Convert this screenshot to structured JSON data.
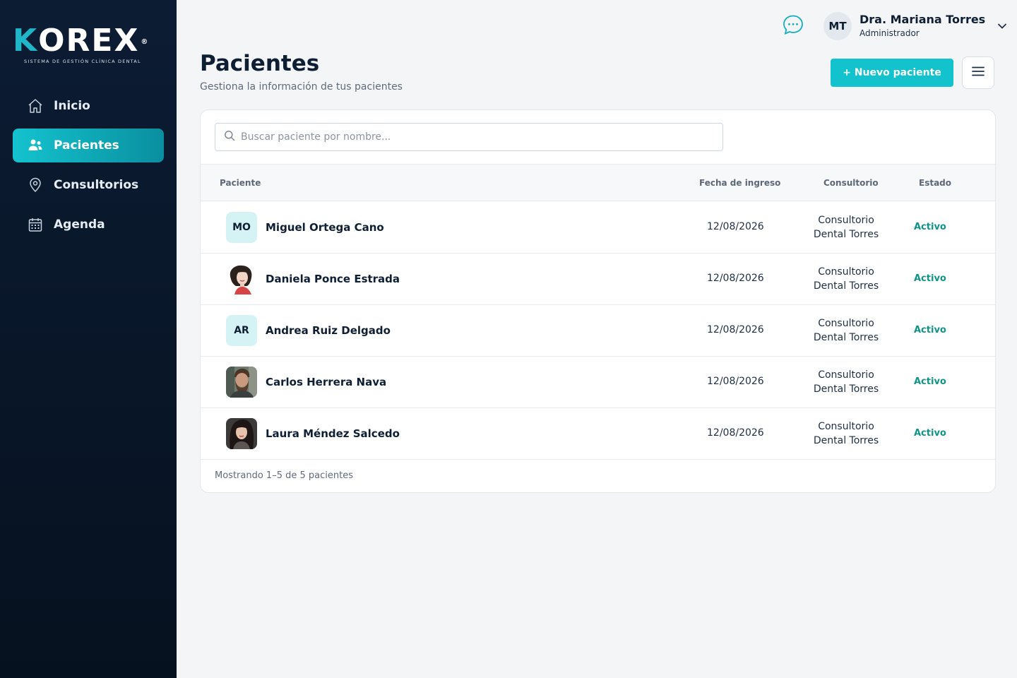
{
  "brand": {
    "name_first": "K",
    "name_rest": "OREX",
    "registered": "®",
    "tagline": "SISTEMA DE GESTIÓN CLÍNICA DENTAL",
    "accent_color": "#1fb6c8"
  },
  "sidebar": {
    "items": [
      {
        "label": "Inicio",
        "icon": "home-icon",
        "active": false
      },
      {
        "label": "Pacientes",
        "icon": "users-icon",
        "active": true
      },
      {
        "label": "Consultorios",
        "icon": "map-pin-icon",
        "active": false
      },
      {
        "label": "Agenda",
        "icon": "calendar-icon",
        "active": false
      }
    ]
  },
  "topbar": {
    "chat_icon": "chat-bubble-icon",
    "user": {
      "initials": "MT",
      "name": "Dra. Mariana Torres",
      "role": "Administrador"
    }
  },
  "header": {
    "title": "Pacientes",
    "subtitle": "Gestiona la información de tus pacientes",
    "new_button": "+ Nuevo paciente",
    "menu_icon": "hamburger-menu-icon"
  },
  "search": {
    "placeholder": "Buscar paciente por nombre...",
    "value": ""
  },
  "table": {
    "columns": {
      "patient": "Paciente",
      "date": "Fecha de ingreso",
      "office": "Consultorio",
      "status": "Estado"
    },
    "rows": [
      {
        "avatar_type": "initials",
        "initials": "MO",
        "name": "Miguel Ortega Cano",
        "date": "12/08/2026",
        "office_line1": "Consultorio",
        "office_line2": "Dental Torres",
        "status": "Activo"
      },
      {
        "avatar_type": "photo",
        "photo": "female-portrait-illustration",
        "name": "Daniela Ponce Estrada",
        "date": "12/08/2026",
        "office_line1": "Consultorio",
        "office_line2": "Dental Torres",
        "status": "Activo"
      },
      {
        "avatar_type": "initials",
        "initials": "AR",
        "name": "Andrea Ruiz Delgado",
        "date": "12/08/2026",
        "office_line1": "Consultorio",
        "office_line2": "Dental Torres",
        "status": "Activo"
      },
      {
        "avatar_type": "photo",
        "photo": "bearded-man-photo",
        "name": "Carlos Herrera Nava",
        "date": "12/08/2026",
        "office_line1": "Consultorio",
        "office_line2": "Dental Torres",
        "status": "Activo"
      },
      {
        "avatar_type": "photo",
        "photo": "dark-haired-woman-photo",
        "name": "Laura Méndez Salcedo",
        "date": "12/08/2026",
        "office_line1": "Consultorio",
        "office_line2": "Dental Torres",
        "status": "Activo"
      }
    ]
  },
  "footer": {
    "summary": "Mostrando 1–5 de 5 pacientes"
  },
  "colors": {
    "primary": "#12c2cc",
    "status_active": "#0f9488",
    "sidebar_bg": "#0c1c33"
  }
}
